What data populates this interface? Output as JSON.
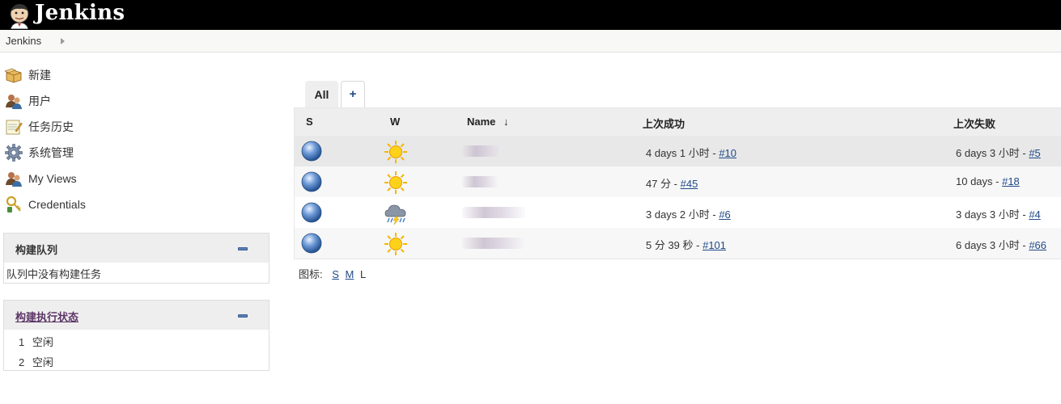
{
  "header": {
    "title": "Jenkins"
  },
  "breadcrumb": {
    "items": [
      "Jenkins"
    ]
  },
  "tasks": [
    {
      "label": "新建",
      "icon": "new-package-icon"
    },
    {
      "label": "用户",
      "icon": "users-icon"
    },
    {
      "label": "任务历史",
      "icon": "notepad-icon"
    },
    {
      "label": "系统管理",
      "icon": "gear-icon"
    },
    {
      "label": "My Views",
      "icon": "users-icon"
    },
    {
      "label": "Credentials",
      "icon": "credentials-icon"
    }
  ],
  "build_queue": {
    "title": "构建队列",
    "empty_message": "队列中没有构建任务"
  },
  "executors": {
    "title": "构建执行状态",
    "items": [
      {
        "num": "1",
        "status": "空闲"
      },
      {
        "num": "2",
        "status": "空闲"
      }
    ]
  },
  "tabs": {
    "all": "All",
    "add": "+"
  },
  "table": {
    "headers": {
      "s": "S",
      "w": "W",
      "name": "Name",
      "sort_arrow": "↓",
      "last_success": "上次成功",
      "last_failure": "上次失败"
    },
    "rows": [
      {
        "status": "blue",
        "weather": "sunny",
        "name": "",
        "last_success_text": "4 days 1 小时 - ",
        "last_success_link": "#10",
        "last_failure_text": "6 days 3 小时 - ",
        "last_failure_link": "#5"
      },
      {
        "status": "blue",
        "weather": "sunny",
        "name": "",
        "last_success_text": "47 分 - ",
        "last_success_link": "#45",
        "last_failure_text": "10 days - ",
        "last_failure_link": "#18"
      },
      {
        "status": "blue",
        "weather": "rain",
        "name": "",
        "last_success_text": "3 days 2 小时 - ",
        "last_success_link": "#6",
        "last_failure_text": "3 days 3 小时 - ",
        "last_failure_link": "#4"
      },
      {
        "status": "blue",
        "weather": "sunny",
        "name": "",
        "last_success_text": "5 分 39 秒 - ",
        "last_success_link": "#101",
        "last_failure_text": "6 days 3 小时 - ",
        "last_failure_link": "#66"
      }
    ]
  },
  "legend": {
    "label": "图标:",
    "sizes": [
      "S",
      "M",
      "L"
    ]
  }
}
